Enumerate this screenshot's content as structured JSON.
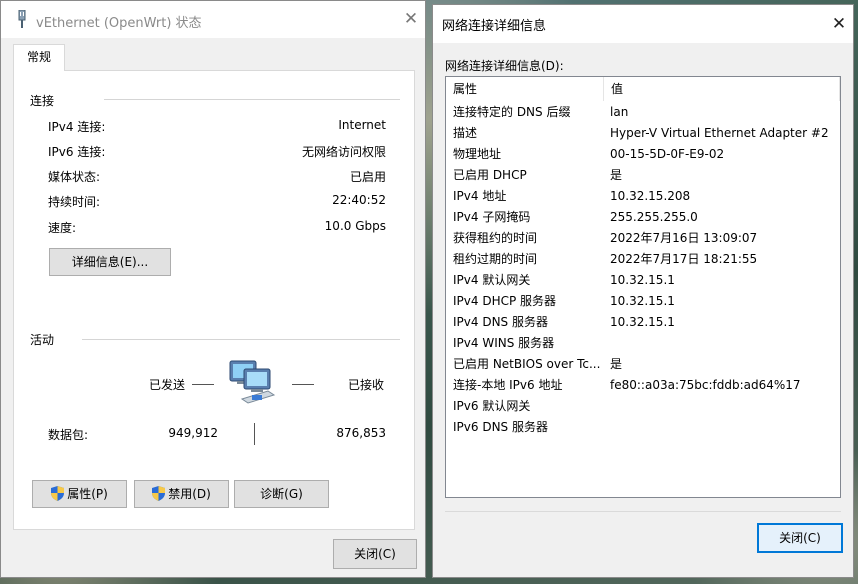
{
  "window1": {
    "title": "vEthernet (OpenWrt) 状态",
    "tab_general": "常规",
    "connection": {
      "group_label": "连接",
      "rows": [
        {
          "label": "IPv4 连接:",
          "value": "Internet"
        },
        {
          "label": "IPv6 连接:",
          "value": "无网络访问权限"
        },
        {
          "label": "媒体状态:",
          "value": "已启用"
        },
        {
          "label": "持续时间:",
          "value": "22:40:52"
        },
        {
          "label": "速度:",
          "value": "10.0 Gbps"
        }
      ],
      "details_button": "详细信息(E)..."
    },
    "activity": {
      "group_label": "活动",
      "sent_label": "已发送",
      "received_label": "已接收",
      "packets_label": "数据包:",
      "packets_sent": "949,912",
      "packets_received": "876,853"
    },
    "buttons": {
      "properties": "属性(P)",
      "disable": "禁用(D)",
      "diagnose": "诊断(G)",
      "close": "关闭(C)"
    }
  },
  "window2": {
    "title": "网络连接详细信息",
    "caption": "网络连接详细信息(D):",
    "columns": {
      "property": "属性",
      "value": "值"
    },
    "rows": [
      {
        "property": "连接特定的 DNS 后缀",
        "value": "lan"
      },
      {
        "property": "描述",
        "value": "Hyper-V Virtual Ethernet Adapter #2"
      },
      {
        "property": "物理地址",
        "value": "00-15-5D-0F-E9-02"
      },
      {
        "property": "已启用 DHCP",
        "value": "是"
      },
      {
        "property": "IPv4 地址",
        "value": "10.32.15.208"
      },
      {
        "property": "IPv4 子网掩码",
        "value": "255.255.255.0"
      },
      {
        "property": "获得租约的时间",
        "value": "2022年7月16日 13:09:07"
      },
      {
        "property": "租约过期的时间",
        "value": "2022年7月17日 18:21:55"
      },
      {
        "property": "IPv4 默认网关",
        "value": "10.32.15.1"
      },
      {
        "property": "IPv4 DHCP 服务器",
        "value": "10.32.15.1"
      },
      {
        "property": "IPv4 DNS 服务器",
        "value": "10.32.15.1"
      },
      {
        "property": "IPv4 WINS 服务器",
        "value": ""
      },
      {
        "property": "已启用 NetBIOS over Tc...",
        "value": "是"
      },
      {
        "property": "连接-本地 IPv6 地址",
        "value": "fe80::a03a:75bc:fddb:ad64%17"
      },
      {
        "property": "IPv6 默认网关",
        "value": ""
      },
      {
        "property": "IPv6 DNS 服务器",
        "value": ""
      }
    ],
    "close_button": "关闭(C)"
  },
  "colors": {
    "window_bg": "#f0f0f0",
    "accent": "#0078d7",
    "button_bg": "#e1e1e1"
  },
  "icons": [
    "network-adapter-icon",
    "close-icon",
    "shield-icon",
    "network-activity-icon"
  ]
}
